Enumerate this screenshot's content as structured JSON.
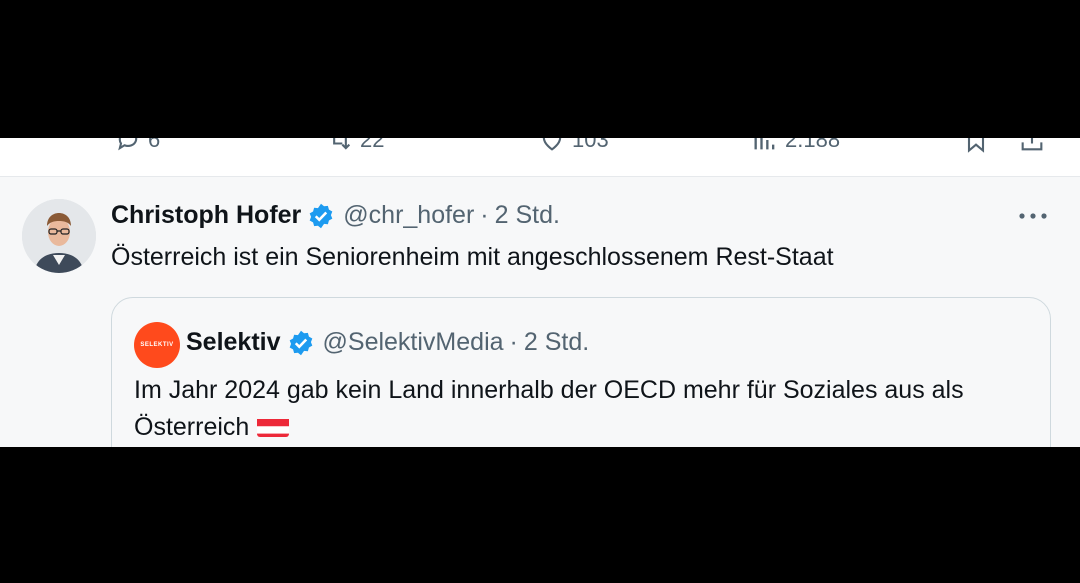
{
  "actions": {
    "reply_count": "6",
    "repost_count": "22",
    "like_count": "103",
    "views_count": "2.188"
  },
  "tweet": {
    "author_name": "Christoph Hofer",
    "handle": "@chr_hofer",
    "separator": "·",
    "time": "2 Std.",
    "text": "Österreich ist ein Seniorenheim mit angeschlossenem Rest-Staat",
    "quoted": {
      "author_name": "Selektiv",
      "handle": "@SelektivMedia",
      "separator": "·",
      "time": "2 Std.",
      "avatar_label": "SELEKTIV",
      "text": "Im Jahr 2024 gab kein Land innerhalb der OECD mehr für Soziales aus als Österreich"
    }
  },
  "colors": {
    "verified": "#1d9bf0",
    "secondary_text": "#536471",
    "selektiv_brand": "#ff4a1c",
    "flag_red": "#ed2939"
  },
  "icons": [
    "reply-icon",
    "repost-icon",
    "like-icon",
    "views-icon",
    "bookmark-icon",
    "share-icon",
    "verified-badge-icon",
    "more-options-icon",
    "austria-flag-icon"
  ]
}
